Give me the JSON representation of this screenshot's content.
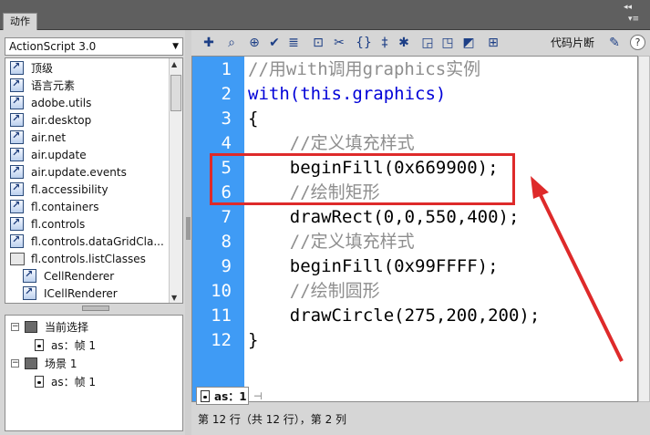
{
  "panel": {
    "tab_label": "动作",
    "controls": {
      "collapse": "◂◂",
      "menu": "▾≡"
    }
  },
  "left_panel": {
    "version_select": {
      "value": "ActionScript 3.0",
      "arrow": "▼"
    },
    "library_items": [
      {
        "label": "顶级",
        "icon": "book-icon",
        "indent": 0
      },
      {
        "label": "语言元素",
        "icon": "book-icon",
        "indent": 0
      },
      {
        "label": "adobe.utils",
        "icon": "book-icon",
        "indent": 0
      },
      {
        "label": "air.desktop",
        "icon": "book-icon",
        "indent": 0
      },
      {
        "label": "air.net",
        "icon": "book-icon",
        "indent": 0
      },
      {
        "label": "air.update",
        "icon": "book-icon",
        "indent": 0
      },
      {
        "label": "air.update.events",
        "icon": "book-icon",
        "indent": 0
      },
      {
        "label": "fl.accessibility",
        "icon": "book-icon",
        "indent": 0
      },
      {
        "label": "fl.containers",
        "icon": "book-icon",
        "indent": 0
      },
      {
        "label": "fl.controls",
        "icon": "book-icon",
        "indent": 0
      },
      {
        "label": "fl.controls.dataGridCla...",
        "icon": "book-icon",
        "indent": 0
      },
      {
        "label": "fl.controls.listClasses",
        "icon": "folder-icon",
        "indent": 0
      },
      {
        "label": "CellRenderer",
        "icon": "book-icon",
        "indent": 1
      },
      {
        "label": "ICellRenderer",
        "icon": "book-icon",
        "indent": 1
      }
    ],
    "scene_tree": [
      {
        "expander": "⊟",
        "icon": "clip-icon",
        "label": "当前选择",
        "depth": 0
      },
      {
        "expander": "",
        "icon": "frame-icon",
        "label": "as：帧 1",
        "depth": 1
      },
      {
        "expander": "⊟",
        "icon": "clip-icon",
        "label": "场景 1",
        "depth": 0
      },
      {
        "expander": "",
        "icon": "frame-icon",
        "label": "as：帧 1",
        "depth": 1
      }
    ]
  },
  "toolbar": {
    "icons": [
      {
        "name": "add-statement-icon",
        "glyph": "✚"
      },
      {
        "name": "find-icon",
        "glyph": "⌕"
      },
      {
        "name": "insert-target-path-icon",
        "glyph": "⊕"
      },
      {
        "name": "check-syntax-icon",
        "glyph": "✔"
      },
      {
        "name": "auto-format-icon",
        "glyph": "≣"
      },
      {
        "name": "show-code-hint-icon",
        "glyph": "⊡"
      },
      {
        "name": "debug-options-icon",
        "glyph": "✂"
      },
      {
        "name": "collapse-between-braces-icon",
        "glyph": "{}"
      },
      {
        "name": "collapse-selection-icon",
        "glyph": "‡"
      },
      {
        "name": "expand-all-icon",
        "glyph": "✱"
      },
      {
        "name": "apply-block-comment-icon",
        "glyph": "◲"
      },
      {
        "name": "apply-line-comment-icon",
        "glyph": "◳"
      },
      {
        "name": "remove-comment-icon",
        "glyph": "◩"
      },
      {
        "name": "show-hide-toolbox-icon",
        "glyph": "⊞"
      }
    ],
    "snippets_label": "代码片断",
    "wand_icon": "✎",
    "help_label": "?"
  },
  "editor": {
    "lines": [
      {
        "n": "1",
        "text": "//用with调用graphics实例",
        "kind": "comment"
      },
      {
        "n": "2",
        "text": "with(this.graphics)",
        "kind": "keyword"
      },
      {
        "n": "3",
        "text": "{",
        "kind": "default"
      },
      {
        "n": "4",
        "text": "    //定义填充样式",
        "kind": "comment"
      },
      {
        "n": "5",
        "text": "    beginFill(0x669900);",
        "kind": "default"
      },
      {
        "n": "6",
        "text": "    //绘制矩形",
        "kind": "comment"
      },
      {
        "n": "7",
        "text": "    drawRect(0,0,550,400);",
        "kind": "default"
      },
      {
        "n": "8",
        "text": "    //定义填充样式",
        "kind": "comment"
      },
      {
        "n": "9",
        "text": "    beginFill(0x99FFFF);",
        "kind": "default"
      },
      {
        "n": "10",
        "text": "    //绘制圆形",
        "kind": "comment"
      },
      {
        "n": "11",
        "text": "    drawCircle(275,200,200);",
        "kind": "default"
      },
      {
        "n": "12",
        "text": "}",
        "kind": "default"
      }
    ],
    "highlighted_lines": [
      "4",
      "5"
    ],
    "annotation_color": "#de2a2a",
    "gutter_color": "#3f9bf5"
  },
  "file_tab": {
    "label": "as：1",
    "pin_glyph": "⊣"
  },
  "status_bar": {
    "text": "第 12 行（共 12 行），第 2 列"
  }
}
